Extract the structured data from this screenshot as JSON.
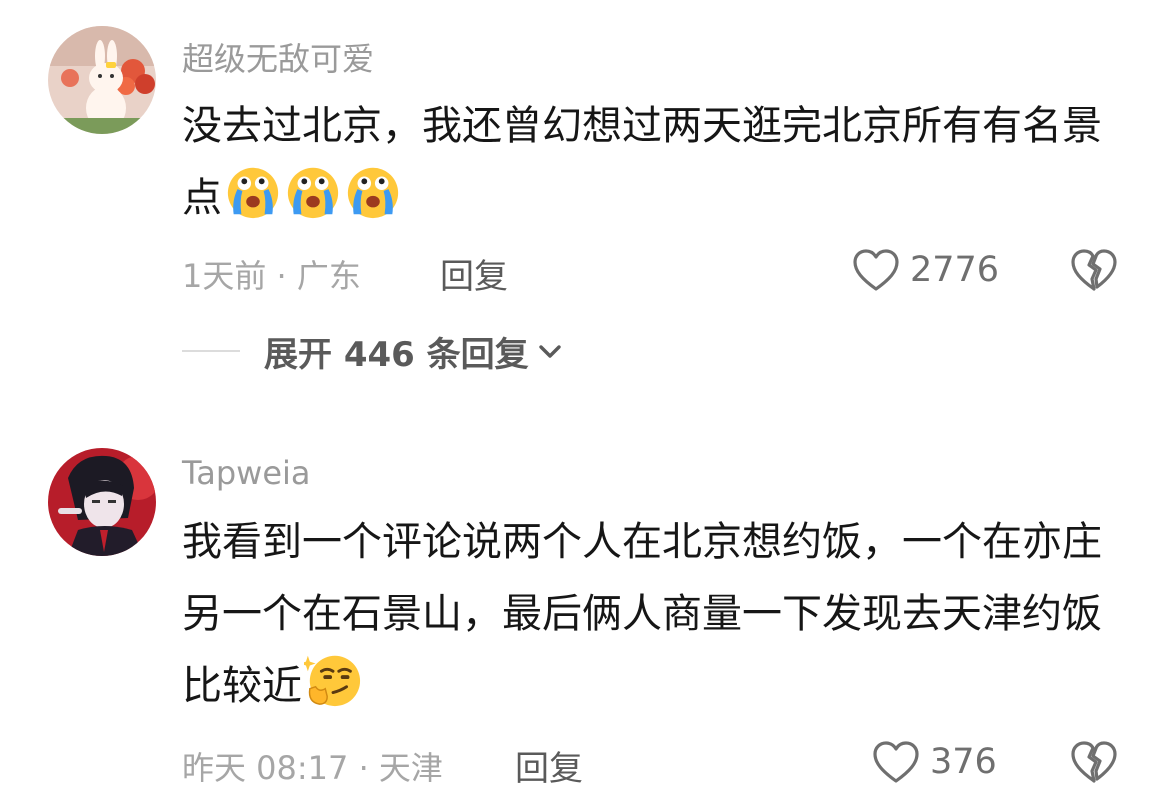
{
  "comments": [
    {
      "username": "超级无敌可爱",
      "text": "没去过北京，我还曾幻想过两天逛完北京所有有名景点",
      "emojis": [
        "crying-face-emoji",
        "crying-face-emoji",
        "crying-face-emoji"
      ],
      "meta": "1天前 · 广东",
      "reply_label": "回复",
      "likes": "2776",
      "expand_label": "展开 446 条回复"
    },
    {
      "username": "Tapweia",
      "text": "我看到一个评论说两个人在北京想约饭，一个在亦庄另一个在石景山，最后俩人商量一下发现去天津约饭比较近",
      "emojis": [
        "smirk-face-emoji"
      ],
      "meta": "昨天 08:17 · 天津",
      "reply_label": "回复",
      "likes": "376"
    }
  ],
  "icons": {
    "like": "heart-outline-icon",
    "dislike": "broken-heart-icon",
    "expand": "chevron-down-icon"
  },
  "colors": {
    "username": "#9a9a9a",
    "text": "#161616",
    "meta": "#a6a6a6",
    "action": "#5a5a5a",
    "emoji_yellow": "#ffc83a",
    "emoji_tear": "#3d9af2"
  }
}
